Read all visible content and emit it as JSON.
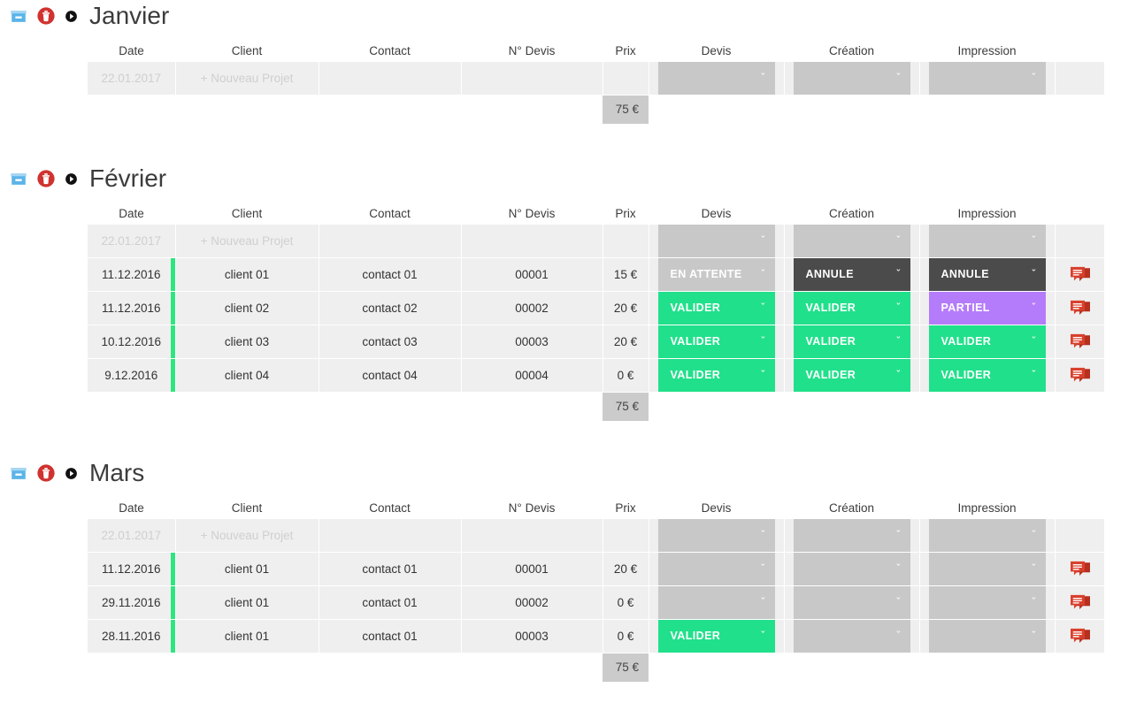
{
  "columns": [
    "Date",
    "Client",
    "Contact",
    "N° Devis",
    "Prix",
    "Devis",
    "Création",
    "Impression"
  ],
  "colors": {
    "valider": "#21e08b",
    "en_attente": "#fc4c54",
    "annule": "#4b4b4b",
    "partiel": "#b47cfa",
    "empty": "#c8c8c8",
    "flag": "#2ee67f",
    "archive_icon": "#5bb4e8",
    "trash_icon": "#d0332f",
    "comment_icon": "#d9402c",
    "total_bg": "#cbcbcb",
    "row_bg": "#efefef"
  },
  "icons": {
    "archive": "archive-icon",
    "trash": "trash-icon",
    "collapse": "collapse-arrow-icon",
    "comment": "comment-icon",
    "chevron": "chevron-down-icon"
  },
  "new_project": {
    "date": "22.01.2017",
    "label": "+ Nouveau Projet"
  },
  "months": [
    {
      "name": "Janvier",
      "total": "75 €",
      "rows": []
    },
    {
      "name": "Février",
      "total": "75 €",
      "rows": [
        {
          "date": "11.12.2016",
          "client": "client 01",
          "contact": "contact 01",
          "devis_no": "00001",
          "prix": "15 €",
          "devis": {
            "label": "EN ATTENTE",
            "state": "en_attente"
          },
          "creation": {
            "label": "ANNULE",
            "state": "annule"
          },
          "impression": {
            "label": "ANNULE",
            "state": "annule"
          }
        },
        {
          "date": "11.12.2016",
          "client": "client 02",
          "contact": "contact 02",
          "devis_no": "00002",
          "prix": "20 €",
          "devis": {
            "label": "VALIDER",
            "state": "valider"
          },
          "creation": {
            "label": "VALIDER",
            "state": "valider"
          },
          "impression": {
            "label": "PARTIEL",
            "state": "partiel"
          }
        },
        {
          "date": "10.12.2016",
          "client": "client 03",
          "contact": "contact 03",
          "devis_no": "00003",
          "prix": "20 €",
          "devis": {
            "label": "VALIDER",
            "state": "valider"
          },
          "creation": {
            "label": "VALIDER",
            "state": "valider"
          },
          "impression": {
            "label": "VALIDER",
            "state": "valider"
          }
        },
        {
          "date": "9.12.2016",
          "client": "client 04",
          "contact": "contact 04",
          "devis_no": "00004",
          "prix": "0 €",
          "devis": {
            "label": "VALIDER",
            "state": "valider"
          },
          "creation": {
            "label": "VALIDER",
            "state": "valider"
          },
          "impression": {
            "label": "VALIDER",
            "state": "valider"
          }
        }
      ]
    },
    {
      "name": "Mars",
      "total": "75 €",
      "rows": [
        {
          "date": "11.12.2016",
          "client": "client 01",
          "contact": "contact 01",
          "devis_no": "00001",
          "prix": "20 €",
          "devis": {
            "label": "",
            "state": "empty"
          },
          "creation": {
            "label": "",
            "state": "empty"
          },
          "impression": {
            "label": "",
            "state": "empty"
          }
        },
        {
          "date": "29.11.2016",
          "client": "client 01",
          "contact": "contact 01",
          "devis_no": "00002",
          "prix": "0 €",
          "devis": {
            "label": "",
            "state": "empty"
          },
          "creation": {
            "label": "",
            "state": "empty"
          },
          "impression": {
            "label": "",
            "state": "empty"
          }
        },
        {
          "date": "28.11.2016",
          "client": "client 01",
          "contact": "contact 01",
          "devis_no": "00003",
          "prix": "0 €",
          "devis": {
            "label": "VALIDER",
            "state": "valider"
          },
          "creation": {
            "label": "",
            "state": "empty"
          },
          "impression": {
            "label": "",
            "state": "empty"
          }
        }
      ]
    }
  ]
}
